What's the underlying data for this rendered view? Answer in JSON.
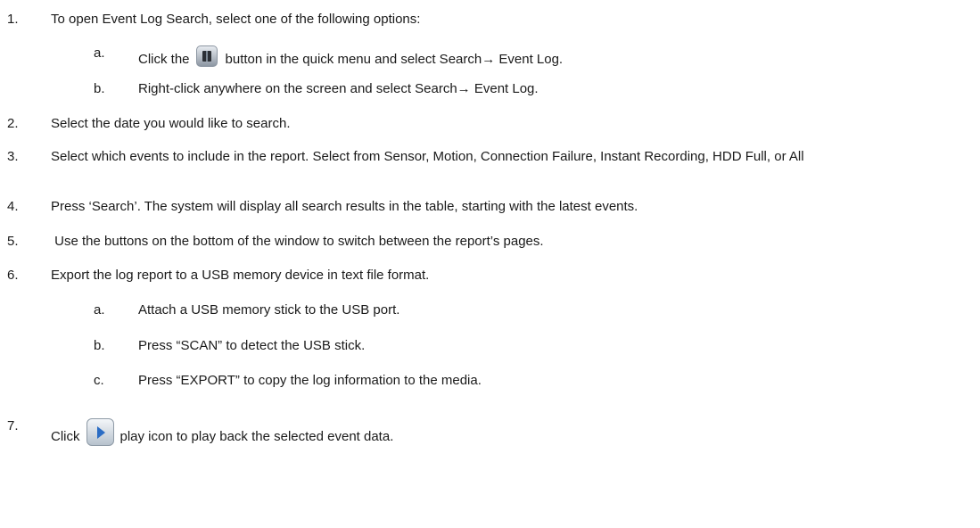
{
  "steps": [
    {
      "num": "1.",
      "text": "To open Event Log Search, select one of the following options:"
    },
    {
      "num": "2.",
      "text": "Select the date you would like to search."
    },
    {
      "num": "3.",
      "text": "Select which events to include in the report. Select from Sensor, Motion, Connection Failure, Instant Recording, HDD Full, or All"
    },
    {
      "num": "4.",
      "text": "Press ‘Search’. The system will display all search results in the table, starting with the latest events."
    },
    {
      "num": "5.",
      "text": " Use the buttons on the bottom of the window to switch between the report’s pages."
    },
    {
      "num": "6.",
      "text": "Export the log report to a USB memory device in text file format."
    },
    {
      "num": "7.",
      "pre": "Click",
      "post": "play icon to play back the selected event data."
    }
  ],
  "step1_sub": [
    {
      "letter": "a.",
      "pre": "Click the",
      "post": "button in the quick menu and select Search→ Event Log."
    },
    {
      "letter": "b.",
      "text": "Right-click anywhere on the screen and select Search→ Event Log."
    }
  ],
  "step6_sub": [
    {
      "letter": "a.",
      "text": "Attach a USB memory stick to the USB port."
    },
    {
      "letter": "b.",
      "text": "Press “SCAN” to detect the USB stick."
    },
    {
      "letter": "c.",
      "text": "Press “EXPORT” to copy the log information to the media."
    }
  ],
  "icons": {
    "quick_menu": "quick-menu-icon",
    "play": "play-icon",
    "play_color": "#2a6cc4"
  }
}
